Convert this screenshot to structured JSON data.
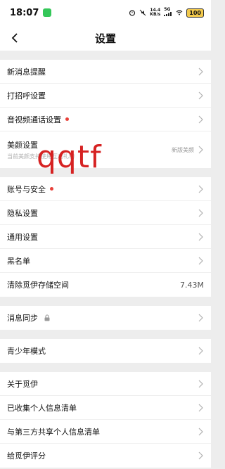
{
  "status_bar": {
    "time": "18:07",
    "net_speed_value": "14.4",
    "net_speed_unit": "KB/s",
    "signal": "5G",
    "battery": "100"
  },
  "header": {
    "title": "设置"
  },
  "groups": [
    {
      "items": [
        {
          "label": "新消息提醒"
        },
        {
          "label": "打招呼设置"
        },
        {
          "label": "音视频通话设置",
          "dot": true
        },
        {
          "label": "美颜设置",
          "sublabel": "当前美颜支持使用互动礼物",
          "value": "新版美颜"
        }
      ]
    },
    {
      "items": [
        {
          "label": "账号与安全",
          "dot": true
        },
        {
          "label": "隐私设置"
        },
        {
          "label": "通用设置"
        },
        {
          "label": "黑名单"
        },
        {
          "label": "清除觅伊存储空间",
          "value": "7.43M"
        }
      ]
    },
    {
      "items": [
        {
          "label": "消息同步"
        }
      ]
    },
    {
      "items": [
        {
          "label": "青少年模式"
        }
      ]
    },
    {
      "items": [
        {
          "label": "关于觅伊"
        },
        {
          "label": "已收集个人信息清单"
        },
        {
          "label": "与第三方共享个人信息清单"
        },
        {
          "label": "给觅伊评分"
        }
      ]
    }
  ],
  "watermark": "qqtf",
  "colors": {
    "accent_dot": "#e8413a",
    "background": "#ededed"
  }
}
